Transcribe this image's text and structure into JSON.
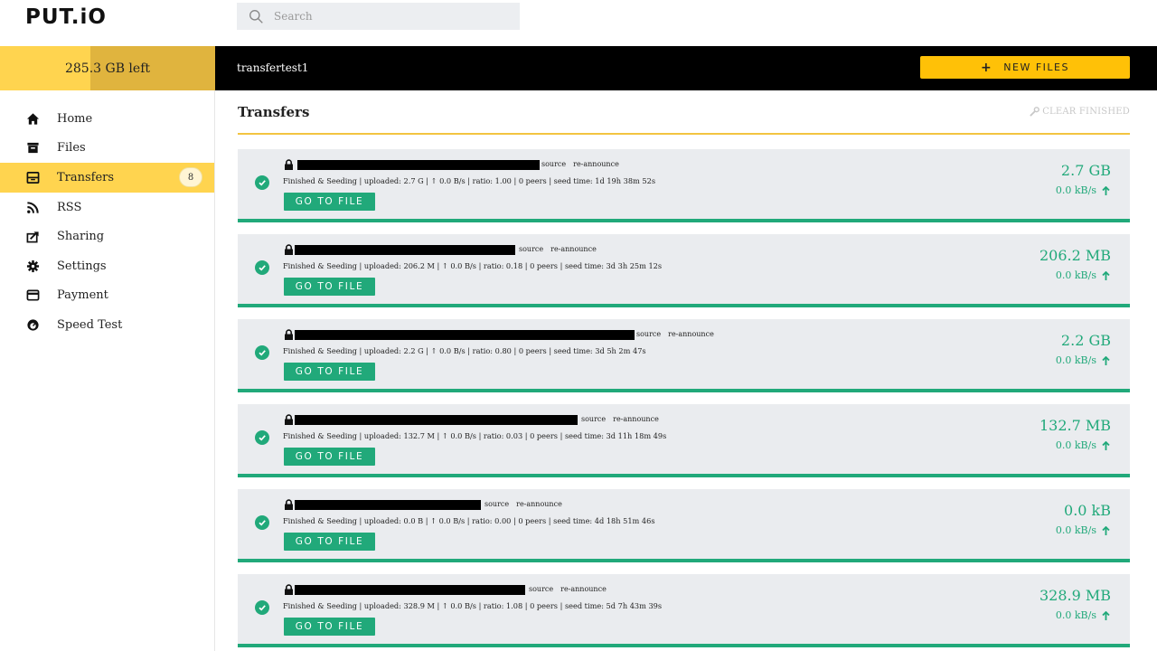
{
  "app": {
    "logo": "PUT.iO"
  },
  "search": {
    "placeholder": "Search"
  },
  "storage": {
    "label": "285.3 GB left"
  },
  "header": {
    "username": "transfertest1",
    "new_files_label": "NEW FILES"
  },
  "sidebar": {
    "items": [
      {
        "label": "Home",
        "icon": "home-icon"
      },
      {
        "label": "Files",
        "icon": "files-icon"
      },
      {
        "label": "Transfers",
        "icon": "transfers-icon",
        "badge": "8",
        "active": true
      },
      {
        "label": "RSS",
        "icon": "rss-icon"
      },
      {
        "label": "Sharing",
        "icon": "share-icon"
      },
      {
        "label": "Settings",
        "icon": "gear-icon"
      },
      {
        "label": "Payment",
        "icon": "credit-card-icon"
      },
      {
        "label": "Speed Test",
        "icon": "speedometer-icon"
      }
    ]
  },
  "main": {
    "title": "Transfers",
    "clear_label": "CLEAR FINISHED",
    "source_label": "source",
    "reannounce_label": "re-announce",
    "goto_label": "GO TO FILE",
    "transfers": [
      {
        "status": "Finished & Seeding | uploaded: 2.7 G | ↑ 0.0 B/s | ratio: 1.00 | 0 peers | seed time: 1d 19h 38m 52s",
        "size": "2.7 GB",
        "speed": "0.0 kB/s"
      },
      {
        "status": "Finished & Seeding | uploaded: 206.2 M | ↑ 0.0 B/s | ratio: 0.18 | 0 peers | seed time: 3d 3h 25m 12s",
        "size": "206.2 MB",
        "speed": "0.0 kB/s"
      },
      {
        "status": "Finished & Seeding | uploaded: 2.2 G | ↑ 0.0 B/s | ratio: 0.80 | 0 peers | seed time: 3d 5h 2m 47s",
        "size": "2.2 GB",
        "speed": "0.0 kB/s"
      },
      {
        "status": "Finished & Seeding | uploaded: 132.7 M | ↑ 0.0 B/s | ratio: 0.03 | 0 peers | seed time: 3d 11h 18m 49s",
        "size": "132.7 MB",
        "speed": "0.0 kB/s"
      },
      {
        "status": "Finished & Seeding | uploaded: 0.0 B | ↑ 0.0 B/s | ratio: 0.00 | 0 peers | seed time: 4d 18h 51m 46s",
        "size": "0.0 kB",
        "speed": "0.0 kB/s"
      },
      {
        "status": "Finished & Seeding | uploaded: 328.9 M | ↑ 0.0 B/s | ratio: 1.08 | 0 peers | seed time: 5d 7h 43m 39s",
        "size": "328.9 MB",
        "speed": "0.0 kB/s"
      }
    ]
  },
  "colors": {
    "accent_yellow": "#ffd44f",
    "button_yellow": "#ffc107",
    "success_green": "#21a97a",
    "card_bg": "#eaecef"
  }
}
